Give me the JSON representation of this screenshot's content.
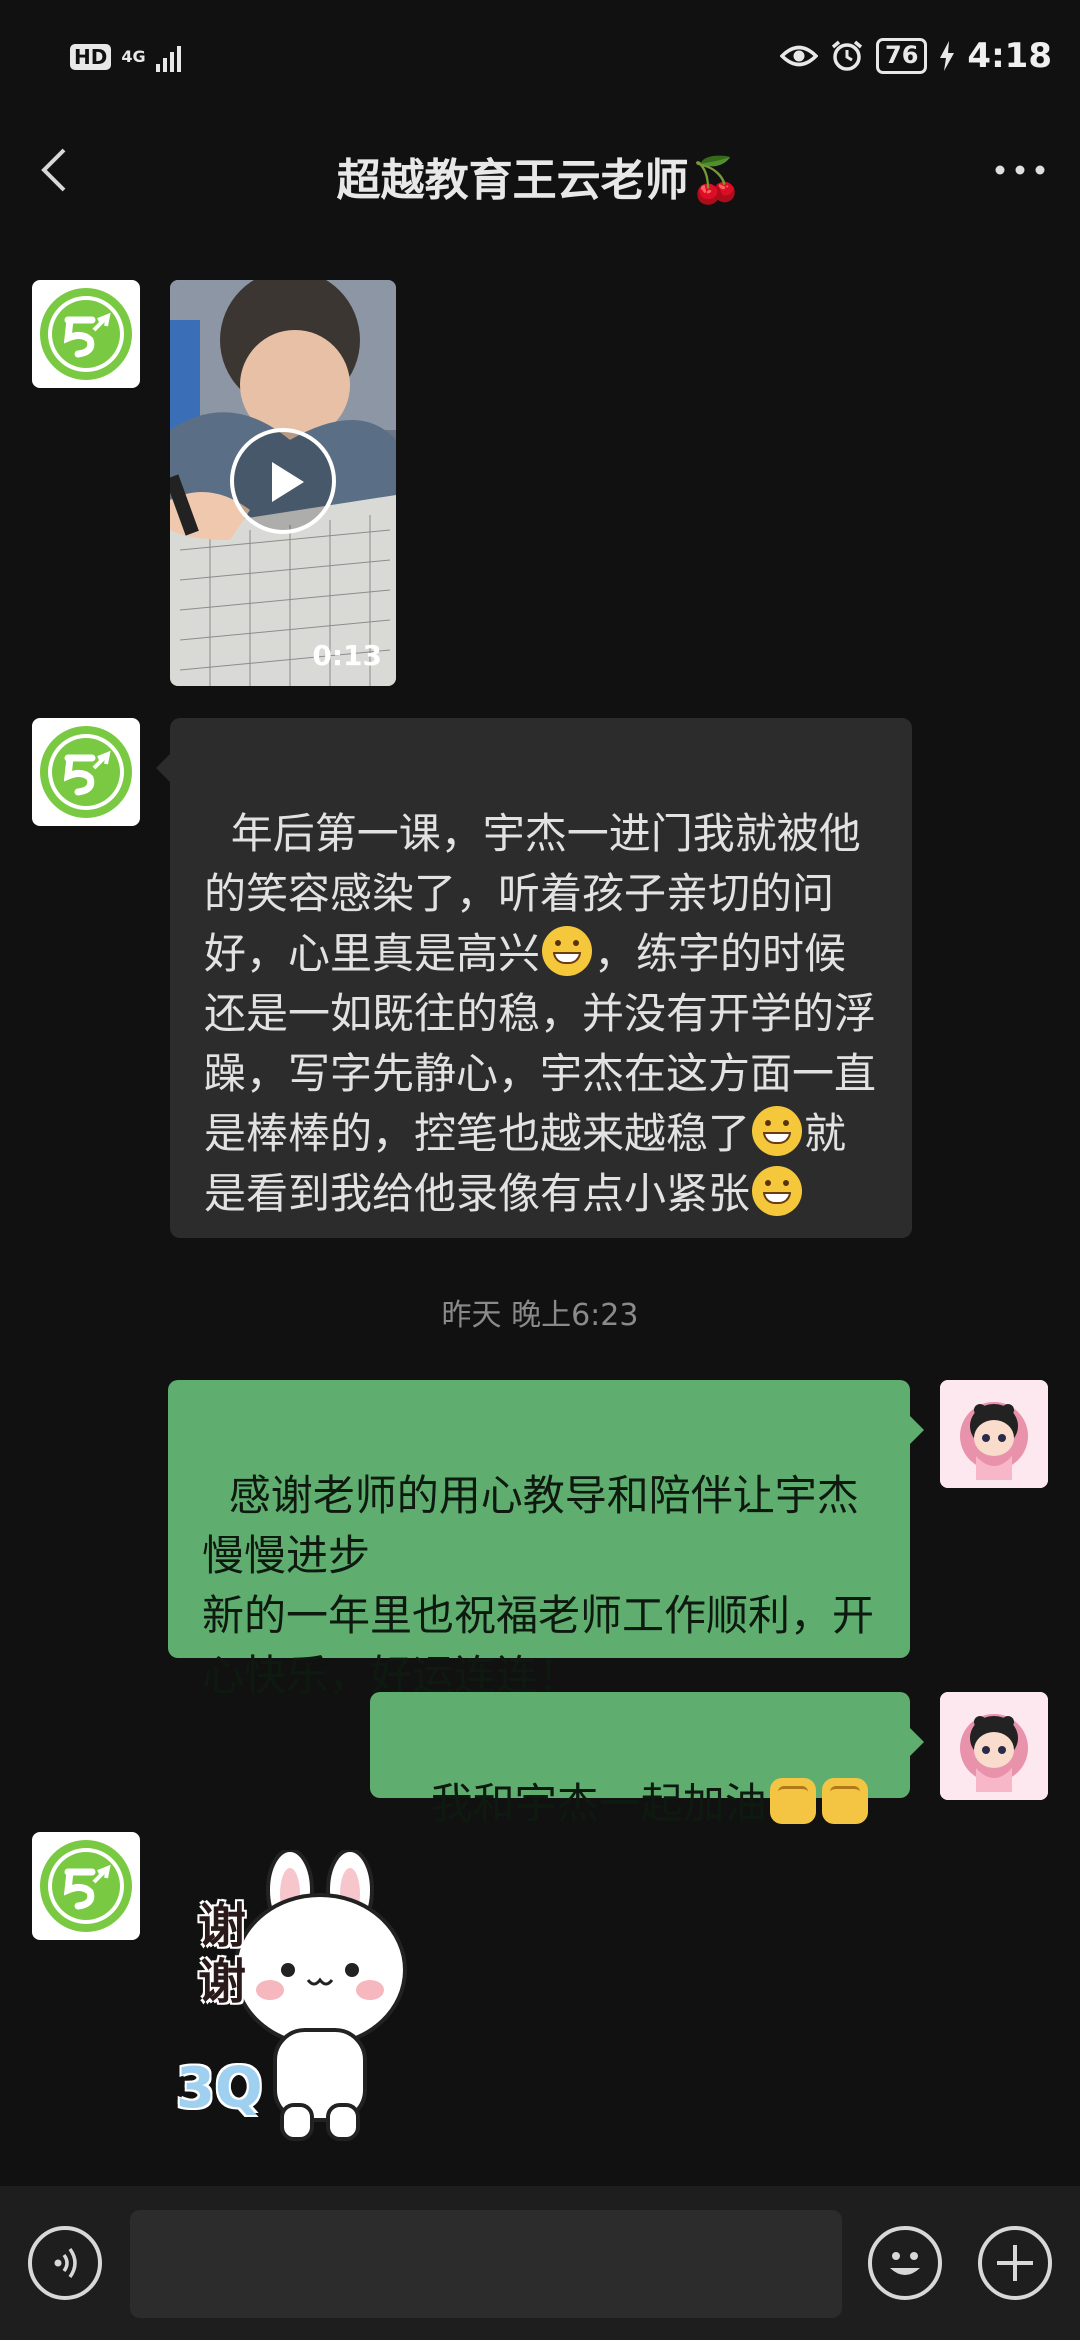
{
  "status_bar": {
    "hd": "HD",
    "network": "4G",
    "battery": "76",
    "time": "4:18"
  },
  "nav": {
    "title": "超越教育王云老师🍒"
  },
  "messages": {
    "video_duration": "0:13",
    "teacher_text_1": "年后第一课，宇杰一进门我就被他的笑容感染了，听着孩子亲切的问好，心里真是高兴",
    "teacher_text_2": "，练字的时候还是一如既往的稳，并没有开学的浮躁，写字先静心，宇杰在这方面一直是棒棒的，控笔也越来越稳了",
    "teacher_text_3": "就是看到我给他录像有点小紧张",
    "timestamp": "昨天 晚上6:23",
    "parent_text_1": "感谢老师的用心教导和陪伴让宇杰慢慢进步\n新的一年里也祝福老师工作顺利，开心快乐，好运连连！",
    "parent_text_2": "我和宇杰一起加油"
  },
  "sticker": {
    "text_top": "谢",
    "text_mid": "谢",
    "text_bottom": "3Q"
  },
  "input_bar": {
    "placeholder": ""
  },
  "colors": {
    "background": "#111111",
    "incoming_bubble": "#2c2c2c",
    "outgoing_bubble": "#5fae6f",
    "logo_green": "#7ac943"
  }
}
